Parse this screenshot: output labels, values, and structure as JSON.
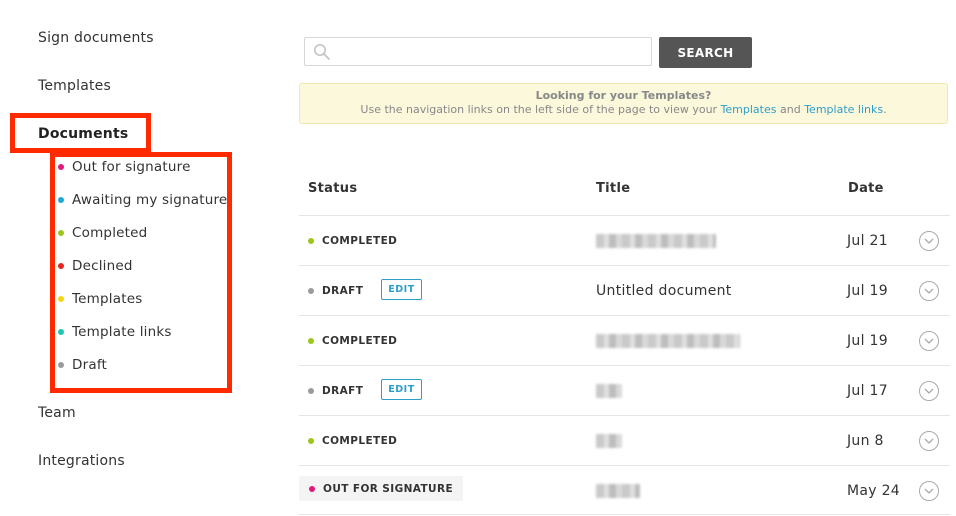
{
  "sidebar": {
    "main": [
      {
        "label": "Sign documents"
      },
      {
        "label": "Templates"
      },
      {
        "label": "Documents"
      },
      {
        "label": "Team"
      },
      {
        "label": "Integrations"
      }
    ],
    "sub": [
      {
        "label": "Out for signature",
        "color": "#e0197a"
      },
      {
        "label": "Awaiting my signature",
        "color": "#1ea7d6"
      },
      {
        "label": "Completed",
        "color": "#9cc51e"
      },
      {
        "label": "Declined",
        "color": "#e6251f"
      },
      {
        "label": "Templates",
        "color": "#f2d615"
      },
      {
        "label": "Template links",
        "color": "#1fc7b3"
      },
      {
        "label": "Draft",
        "color": "#9b9b9b"
      }
    ]
  },
  "search": {
    "placeholder": "",
    "value": "",
    "button_label": "SEARCH"
  },
  "notice": {
    "title": "Looking for your Templates?",
    "text_before": "Use the navigation links on the left side of the page to view your ",
    "link1": "Templates",
    "text_middle": " and ",
    "link2": "Template links",
    "text_after": "."
  },
  "table": {
    "headers": {
      "status": "Status",
      "title": "Title",
      "date": "Date"
    },
    "edit_label": "EDIT",
    "rows": [
      {
        "status": "COMPLETED",
        "color": "#9cc51e",
        "title": "",
        "date": "Jul 21"
      },
      {
        "status": "DRAFT",
        "color": "#9b9b9b",
        "title": "Untitled document",
        "date": "Jul 19"
      },
      {
        "status": "COMPLETED",
        "color": "#9cc51e",
        "title": "",
        "date": "Jul 19"
      },
      {
        "status": "DRAFT",
        "color": "#9b9b9b",
        "title": "",
        "date": "Jul 17"
      },
      {
        "status": "COMPLETED",
        "color": "#9cc51e",
        "title": "",
        "date": "Jun 8"
      },
      {
        "status": "OUT FOR SIGNATURE",
        "color": "#e0197a",
        "title": "",
        "date": "May 24"
      }
    ]
  },
  "colors": {
    "accent": "#2d9ec9",
    "highlight": "#ff2a00",
    "button": "#555555",
    "notice_bg": "#fcf8dc"
  }
}
